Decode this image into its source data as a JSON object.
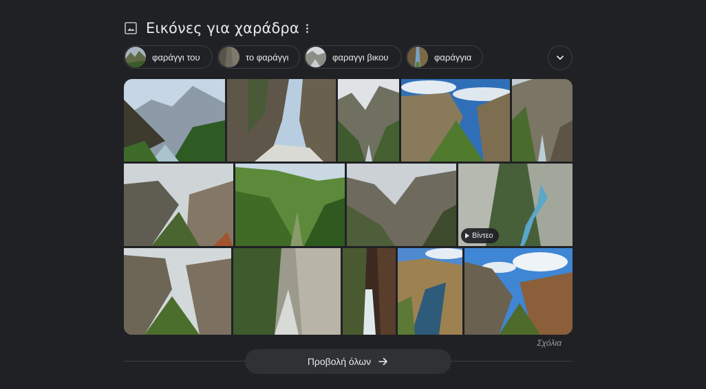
{
  "header": {
    "title": "Εικόνες για χαράδρα",
    "icon": "image-icon",
    "more_icon": "more-vert-icon"
  },
  "chips": [
    {
      "label": "φαράγγι του",
      "thumb_color": "#6b7d52"
    },
    {
      "label": "το φαράγγι",
      "thumb_color": "#7a7468"
    },
    {
      "label": "φαραγγι βικου",
      "thumb_color": "#8e9aa3"
    },
    {
      "label": "φαράγγια",
      "thumb_color": "#5e6f4a"
    }
  ],
  "expand_icon": "chevron-down-icon",
  "video_badge": {
    "label": "Βίντεο",
    "icon": "play-icon"
  },
  "feedback_label": "Σχόλια",
  "view_all": {
    "label": "Προβολή όλων",
    "icon": "arrow-right-icon"
  },
  "colors": {
    "background": "#202124",
    "chip_border": "#3c4043",
    "text": "#e8eaed",
    "muted": "#9aa0a6",
    "button_bg": "#303134"
  }
}
